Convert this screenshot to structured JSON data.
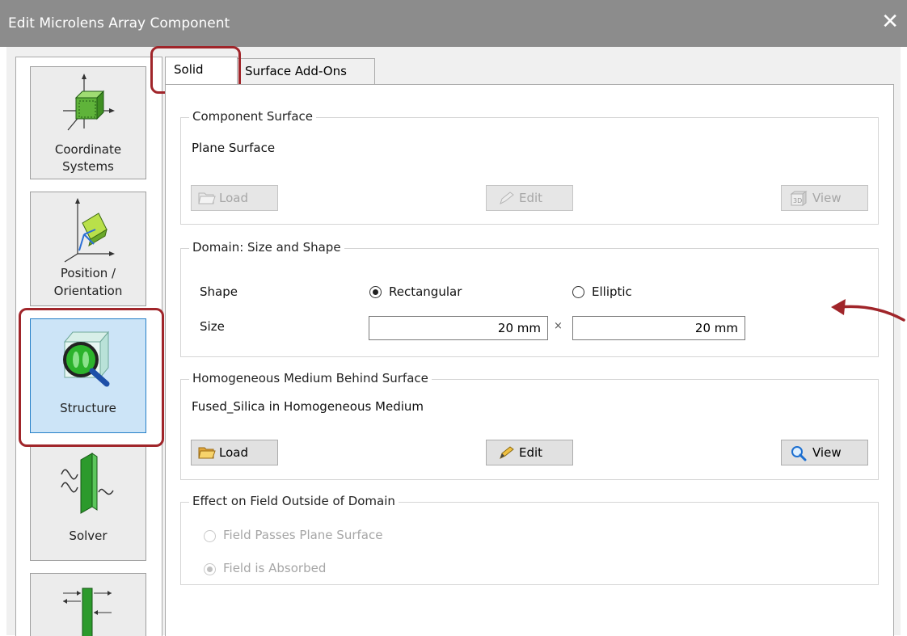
{
  "window": {
    "title": "Edit Microlens Array Component",
    "close_glyph": "✕"
  },
  "sidebar": {
    "items": [
      {
        "label_line1": "Coordinate",
        "label_line2": "Systems",
        "icon": "coordinate-systems-icon",
        "active": false
      },
      {
        "label_line1": "Position /",
        "label_line2": "Orientation",
        "icon": "position-orientation-icon",
        "active": false
      },
      {
        "label_line1": "Structure",
        "label_line2": "",
        "icon": "structure-icon",
        "active": true
      },
      {
        "label_line1": "Solver",
        "label_line2": "",
        "icon": "solver-icon",
        "active": false
      },
      {
        "label_line1": "",
        "label_line2": "",
        "icon": "channels-icon",
        "active": false
      }
    ]
  },
  "tabs": [
    {
      "label": "Solid",
      "active": true
    },
    {
      "label": "Surface Add-Ons",
      "active": false
    }
  ],
  "component_surface": {
    "title": "Component Surface",
    "value": "Plane Surface",
    "load_label": "Load",
    "edit_label": "Edit",
    "view_label": "View"
  },
  "domain": {
    "title": "Domain: Size and Shape",
    "shape_label": "Shape",
    "shape_options": [
      "Rectangular",
      "Elliptic"
    ],
    "shape_selected": "Rectangular",
    "size_label": "Size",
    "size_x": "20 mm",
    "size_times": "×",
    "size_y": "20 mm"
  },
  "medium": {
    "title": "Homogeneous Medium Behind Surface",
    "value": "Fused_Silica in Homogeneous Medium",
    "load_label": "Load",
    "edit_label": "Edit",
    "view_label": "View"
  },
  "effect": {
    "title": "Effect on Field Outside of Domain",
    "options": [
      "Field Passes Plane Surface",
      "Field is Absorbed"
    ],
    "selected": "Field is Absorbed",
    "enabled": false
  },
  "colors": {
    "highlight": "#a0252a",
    "title_bar": "#8c8c8c",
    "active_nav": "#cce4f7"
  }
}
